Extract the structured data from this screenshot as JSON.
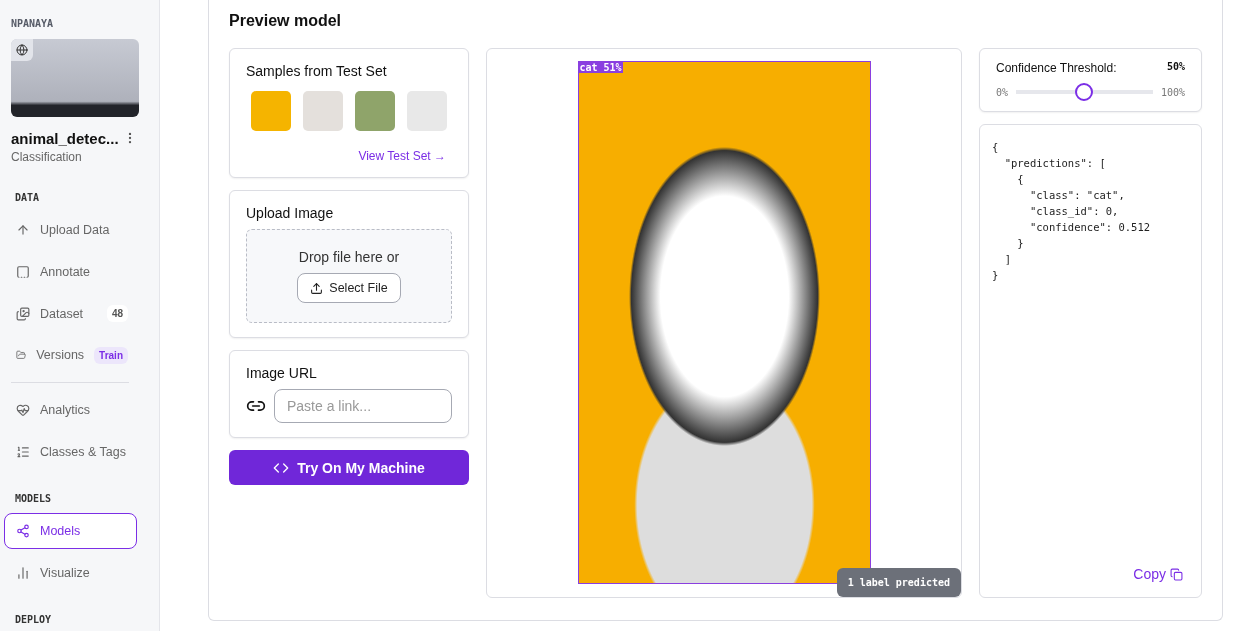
{
  "sidebar": {
    "workspace": "NPANAYA",
    "project": {
      "name": "animal_detec...",
      "type": "Classification"
    },
    "sections": [
      {
        "title": "DATA",
        "groups": [
          {
            "items": [
              {
                "label": "Upload Data",
                "selected": false
              },
              {
                "label": "Annotate",
                "selected": false
              },
              {
                "label": "Dataset",
                "selected": false,
                "badge": {
                  "text": "48",
                  "kind": "count"
                }
              },
              {
                "label": "Versions",
                "selected": false,
                "badge": {
                  "text": "Train",
                  "kind": "tag"
                }
              }
            ]
          },
          {
            "items": [
              {
                "label": "Analytics",
                "selected": false
              },
              {
                "label": "Classes & Tags",
                "selected": false
              }
            ]
          }
        ]
      },
      {
        "title": "MODELS",
        "groups": [
          {
            "items": [
              {
                "label": "Models",
                "selected": true
              },
              {
                "label": "Visualize",
                "selected": false
              }
            ]
          }
        ]
      },
      {
        "title": "DEPLOY"
      }
    ]
  },
  "main": {
    "title": "Preview model",
    "samples": {
      "title": "Samples from Test Set",
      "link": "View Test Set →"
    },
    "upload": {
      "title": "Upload Image",
      "drop_text": "Drop file here or",
      "button": "Select File"
    },
    "url": {
      "title": "Image URL",
      "placeholder": "Paste a link..."
    },
    "run_button": "Try On My Machine",
    "preview": {
      "box_label": "cat 51%",
      "status": "1 label predicted"
    },
    "threshold": {
      "label": "Confidence Threshold:",
      "value": "50%",
      "min": "0%",
      "max": "100%",
      "level": 0.5
    },
    "output": {
      "lines": [
        "{",
        "  \"predictions\": [",
        "    {",
        "      \"class\": \"cat\",",
        "      \"class_id\": 0,",
        "      \"confidence\": 0.512",
        "    }",
        "  ]",
        "}"
      ],
      "copy": "Copy"
    }
  }
}
